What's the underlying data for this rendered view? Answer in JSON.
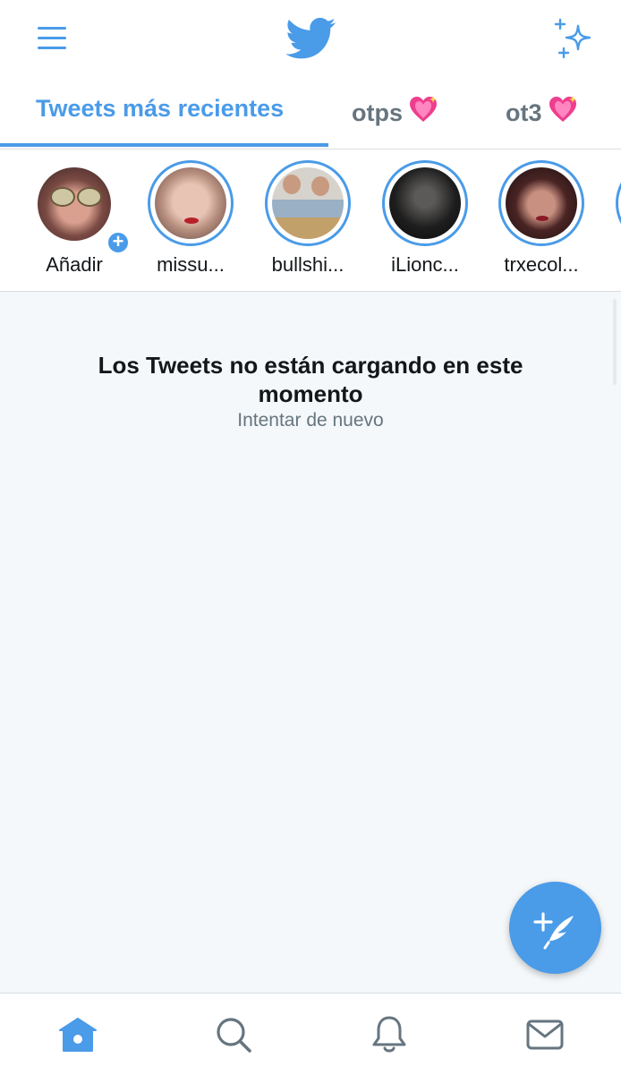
{
  "topbar": {
    "menu_icon": "hamburger-menu-icon",
    "logo_icon": "twitter-bird-icon",
    "sparkle_icon": "sparkle-icon"
  },
  "tabs": [
    {
      "label": "Tweets más recientes",
      "active": true
    },
    {
      "label": "otps",
      "emoji": "💖"
    },
    {
      "label": "ot3",
      "emoji": "💖"
    }
  ],
  "stories": [
    {
      "label": "Añadir",
      "add": true
    },
    {
      "label": "missu..."
    },
    {
      "label": "bullshi..."
    },
    {
      "label": "iLionc..."
    },
    {
      "label": "trxecol..."
    }
  ],
  "main": {
    "error_title": "Los Tweets no están cargando en este momento",
    "retry_label": "Intentar de nuevo"
  },
  "fab": {
    "icon": "compose-tweet-icon"
  },
  "bottom_nav": [
    {
      "name": "home-icon"
    },
    {
      "name": "search-icon"
    },
    {
      "name": "notifications-icon"
    },
    {
      "name": "messages-icon"
    }
  ],
  "colors": {
    "accent": "#4a9be8",
    "text": "#14171a",
    "muted": "#66757f",
    "background": "#f5f8fa"
  }
}
